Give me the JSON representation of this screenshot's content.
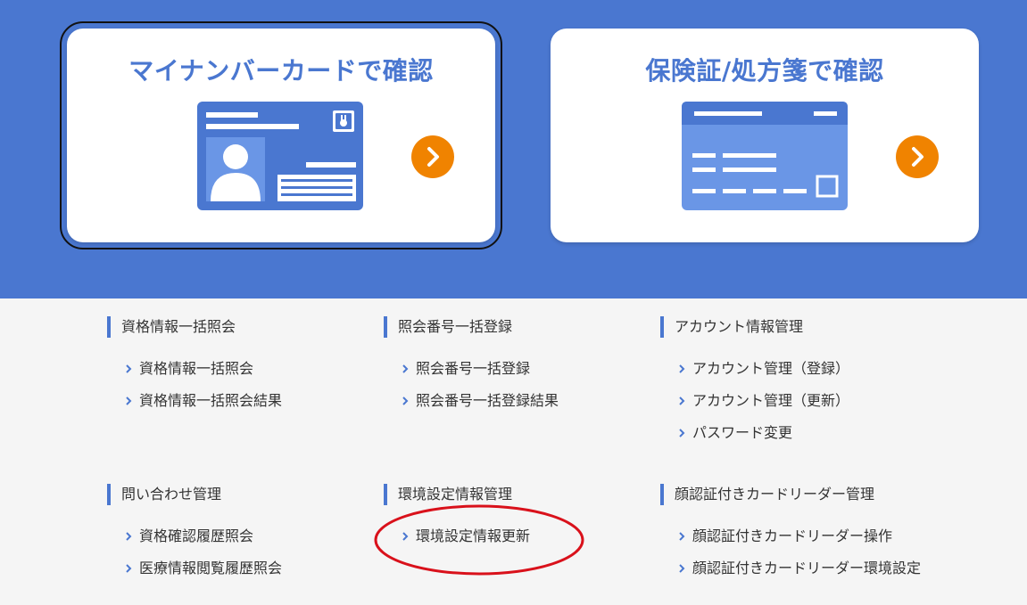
{
  "cards": {
    "mynumber": {
      "title": "マイナンバーカードで確認"
    },
    "insurance": {
      "title": "保険証/処方箋で確認"
    }
  },
  "colors": {
    "hero_bg": "#4a77d0",
    "accent_orange": "#f08300",
    "card_blue": "#4a77d0",
    "highlight_red": "#d9111b"
  },
  "menu": {
    "group1": {
      "heading": "資格情報一括照会",
      "items": [
        "資格情報一括照会",
        "資格情報一括照会結果"
      ]
    },
    "group2": {
      "heading": "照会番号一括登録",
      "items": [
        "照会番号一括登録",
        "照会番号一括登録結果"
      ]
    },
    "group3": {
      "heading": "アカウント情報管理",
      "items": [
        "アカウント管理（登録）",
        "アカウント管理（更新）",
        "パスワード変更"
      ]
    },
    "group4": {
      "heading": "問い合わせ管理",
      "items": [
        "資格確認履歴照会",
        "医療情報閲覧履歴照会"
      ]
    },
    "group5": {
      "heading": "環境設定情報管理",
      "items": [
        "環境設定情報更新"
      ]
    },
    "group6": {
      "heading": "顔認証付きカードリーダー管理",
      "items": [
        "顔認証付きカードリーダー操作",
        "顔認証付きカードリーダー環境設定"
      ]
    }
  }
}
